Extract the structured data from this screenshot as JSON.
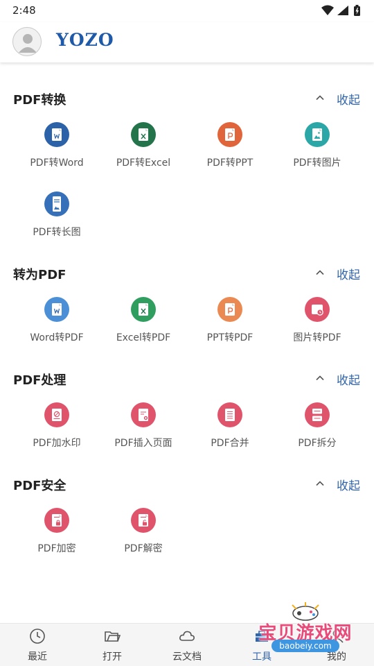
{
  "status_bar": {
    "time": "2:48"
  },
  "header": {
    "brand": "YOZO"
  },
  "sections": [
    {
      "title": "PDF转换",
      "collapse_label": "收起",
      "tools": [
        {
          "label": "PDF转Word",
          "icon": "word-doc-icon",
          "color": "#2b62a8"
        },
        {
          "label": "PDF转Excel",
          "icon": "excel-doc-icon",
          "color": "#23744b"
        },
        {
          "label": "PDF转PPT",
          "icon": "ppt-doc-icon",
          "color": "#e1653b"
        },
        {
          "label": "PDF转图片",
          "icon": "image-doc-icon",
          "color": "#2aa7a6"
        },
        {
          "label": "PDF转长图",
          "icon": "long-image-icon",
          "color": "#3670b8"
        }
      ]
    },
    {
      "title": "转为PDF",
      "collapse_label": "收起",
      "tools": [
        {
          "label": "Word转PDF",
          "icon": "word-doc-icon",
          "color": "#4b8fd6"
        },
        {
          "label": "Excel转PDF",
          "icon": "excel-doc-icon",
          "color": "#2f9e5e"
        },
        {
          "label": "PPT转PDF",
          "icon": "ppt-doc-icon",
          "color": "#ea8a52"
        },
        {
          "label": "图片转PDF",
          "icon": "image-to-pdf-icon",
          "color": "#e0546b"
        }
      ]
    },
    {
      "title": "PDF处理",
      "collapse_label": "收起",
      "tools": [
        {
          "label": "PDF加水印",
          "icon": "watermark-icon",
          "color": "#e0546b"
        },
        {
          "label": "PDF插入页面",
          "icon": "insert-page-icon",
          "color": "#e0546b"
        },
        {
          "label": "PDF合并",
          "icon": "merge-icon",
          "color": "#e0546b"
        },
        {
          "label": "PDF拆分",
          "icon": "split-icon",
          "color": "#e0546b"
        }
      ]
    },
    {
      "title": "PDF安全",
      "collapse_label": "收起",
      "tools": [
        {
          "label": "PDF加密",
          "icon": "lock-doc-icon",
          "color": "#e0546b"
        },
        {
          "label": "PDF解密",
          "icon": "unlock-doc-icon",
          "color": "#e0546b"
        }
      ]
    }
  ],
  "bottom_nav": [
    {
      "label": "最近",
      "icon": "clock-icon"
    },
    {
      "label": "打开",
      "icon": "folder-icon"
    },
    {
      "label": "云文档",
      "icon": "cloud-icon"
    },
    {
      "label": "工具",
      "icon": "toolbox-icon",
      "active": true
    },
    {
      "label": "我的",
      "icon": "person-icon"
    }
  ],
  "watermark": {
    "text": "宝贝游戏网",
    "url": "baobeiy.com"
  },
  "accent_color": "#2f64ad"
}
